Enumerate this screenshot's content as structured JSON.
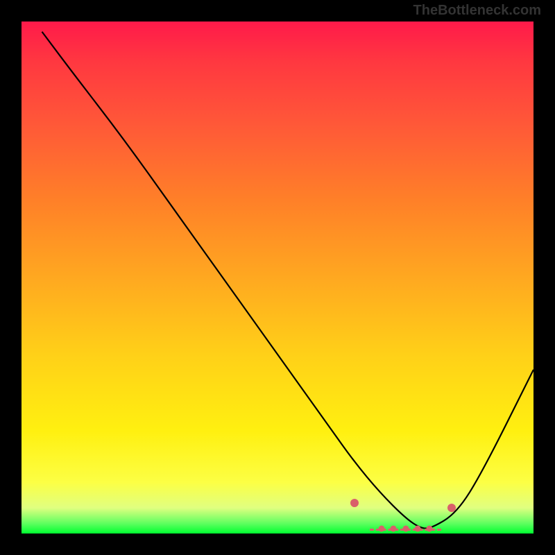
{
  "attribution": "TheBottleneck.com",
  "chart_data": {
    "type": "line",
    "title": "",
    "xlabel": "",
    "ylabel": "",
    "x_range": [
      0,
      100
    ],
    "y_range": [
      0,
      100
    ],
    "series": [
      {
        "name": "bottleneck-curve",
        "x": [
          4,
          10,
          20,
          30,
          40,
          50,
          60,
          65,
          70,
          75,
          78,
          80,
          85,
          90,
          100
        ],
        "y": [
          98,
          90,
          77,
          63,
          49,
          35,
          21,
          14,
          8,
          3,
          1,
          1,
          4,
          12,
          32
        ]
      }
    ],
    "markers": {
      "name": "optimal-range-markers",
      "points": [
        {
          "x": 65,
          "y": 6
        },
        {
          "x": 84,
          "y": 5
        }
      ]
    },
    "optimal_segment": {
      "x_start": 68,
      "x_end": 82,
      "y": 1
    },
    "background_gradient": {
      "top_color": "#ff1a4a",
      "mid_color": "#ffd018",
      "bottom_color": "#00ff30"
    }
  }
}
